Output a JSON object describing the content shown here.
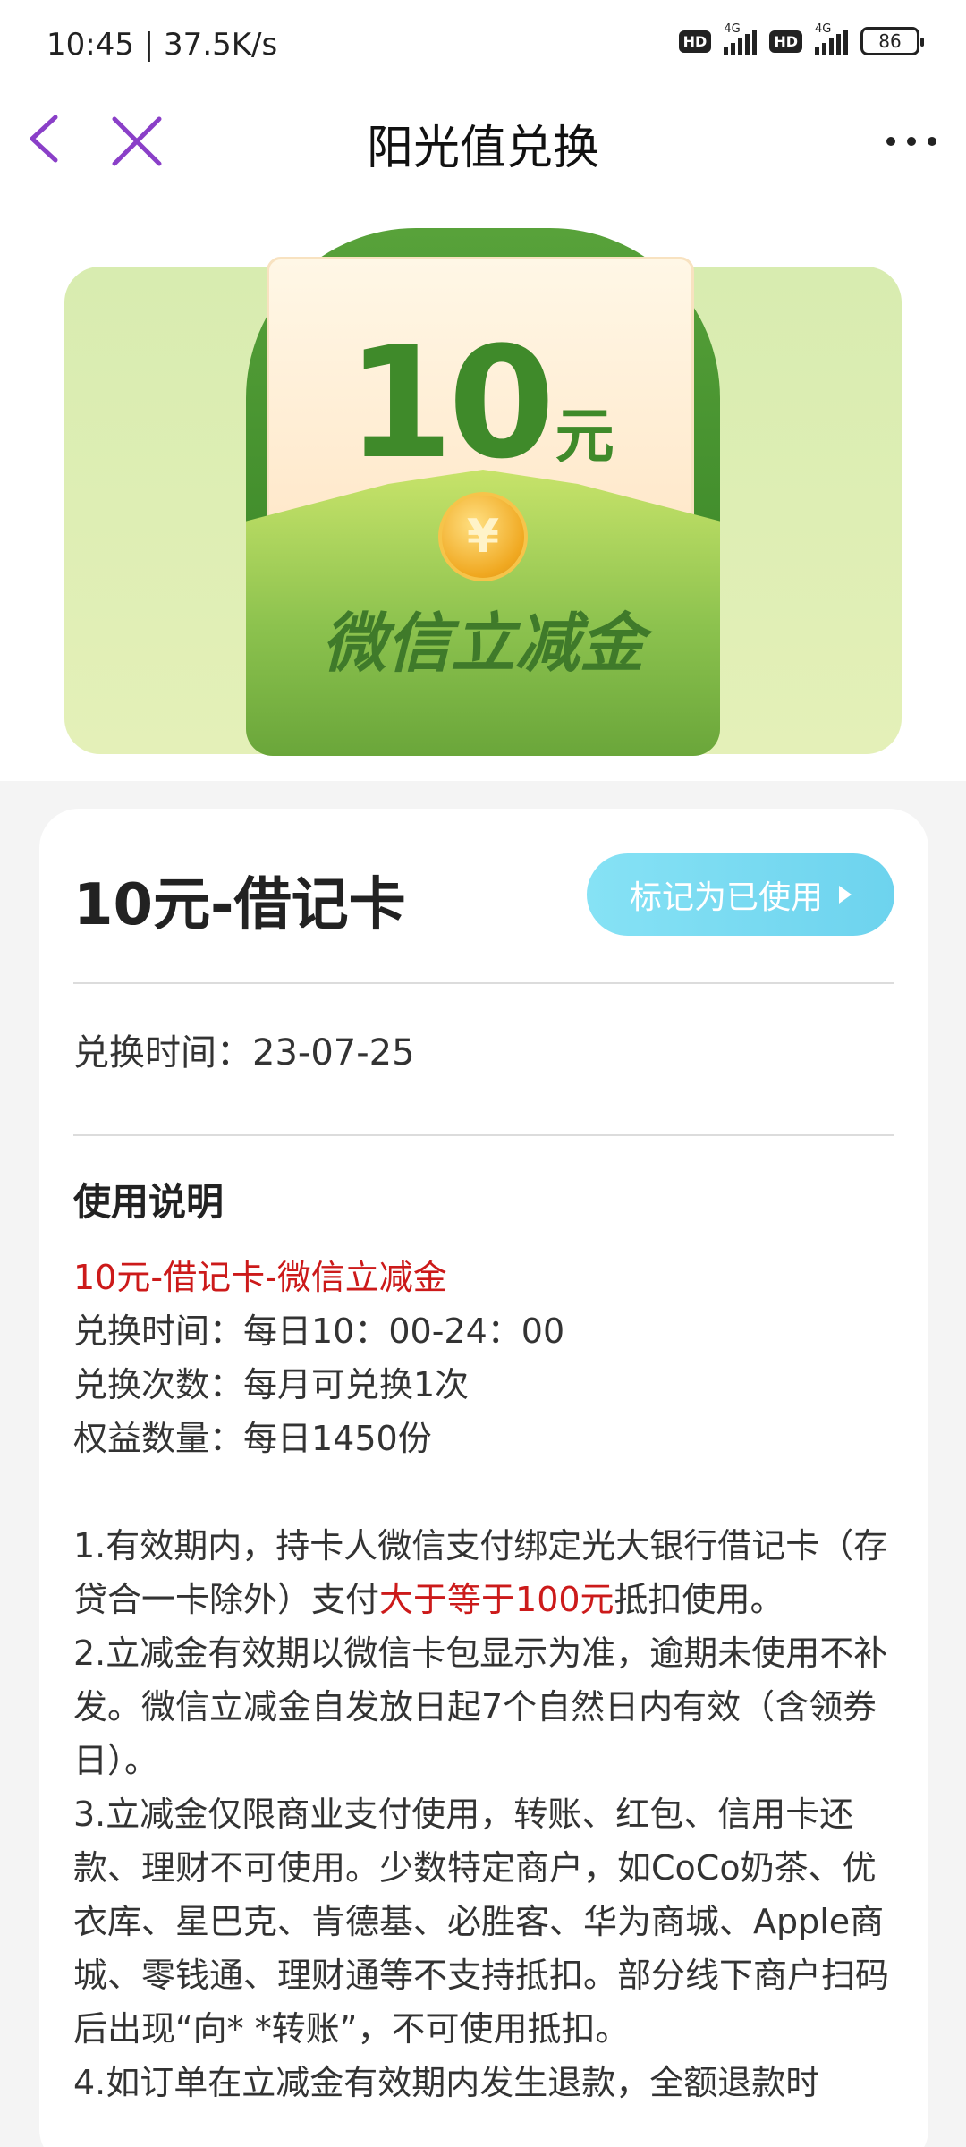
{
  "status_bar": {
    "time_speed": "10:45 | 37.5K/s",
    "hd_label": "HD",
    "net1": "4G",
    "net2": "4G",
    "battery": "86"
  },
  "nav": {
    "title": "阳光值兑换",
    "back_icon": "chevron-left-icon",
    "close_icon": "close-icon",
    "more_icon": "more-horizontal-icon",
    "accent_color": "#8a3fc8"
  },
  "banner": {
    "amount_number": "10",
    "amount_unit": "元",
    "coin_symbol": "¥",
    "caption": "微信立减金"
  },
  "card": {
    "title": "10元-借记卡",
    "mark_used_label": "标记为已使用",
    "exchange_time": "兑换时间：23-07-25",
    "section_title": "使用说明",
    "desc_red_title": "10元-借记卡-微信立减金",
    "desc_time": "兑换时间：每日10：00-24：00",
    "desc_count": "兑换次数：每月可兑换1次",
    "desc_quantity": "权益数量：每日1450份",
    "rule1_a": "1.有效期内，持卡人微信支付绑定光大银行借记卡（存贷合一卡除外）支付",
    "rule1_red": "大于等于100元",
    "rule1_b": "抵扣使用。",
    "rule2": "2.立减金有效期以微信卡包显示为准，逾期未使用不补发。微信立减金自发放日起7个自然日内有效（含领券日）。",
    "rule3": "3.立减金仅限商业支付使用，转账、红包、信用卡还款、理财不可使用。少数特定商户，如CoCo奶茶、优衣库、星巴克、肯德基、必胜客、华为商城、Apple商城、零钱通、理财通等不支持抵扣。部分线下商户扫码后出现“向* *转账”，不可使用抵扣。",
    "rule4": "4.如订单在立减金有效期内发生退款，全额退款时"
  }
}
